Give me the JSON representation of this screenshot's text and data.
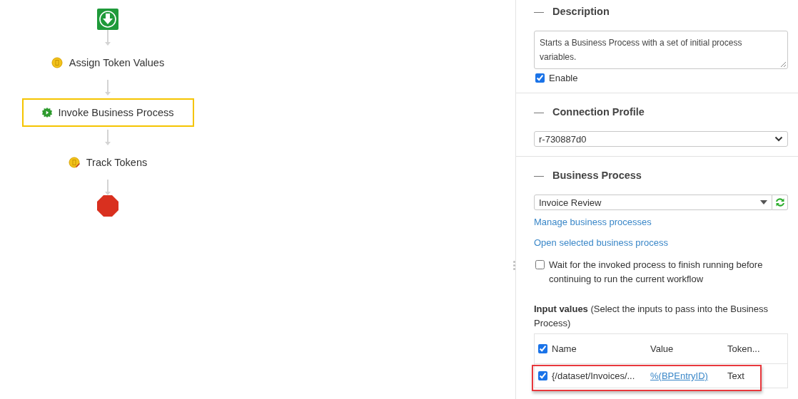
{
  "flow": {
    "nodes": [
      {
        "kind": "start",
        "selected": false
      },
      {
        "kind": "assign",
        "label": "Assign Token Values",
        "selected": false
      },
      {
        "kind": "invoke",
        "label": "Invoke Business Process",
        "selected": true
      },
      {
        "kind": "track",
        "label": "Track Tokens",
        "selected": false
      },
      {
        "kind": "end",
        "selected": false
      }
    ]
  },
  "panel": {
    "description": {
      "title": "Description",
      "collapse": "—",
      "text": "Starts a Business Process with a set of initial process variables.",
      "enable": {
        "label": "Enable",
        "checked": true
      }
    },
    "connection_profile": {
      "title": "Connection Profile",
      "collapse": "—",
      "value": "r-730887d0"
    },
    "business_process": {
      "title": "Business Process",
      "collapse": "—",
      "value": "Invoice Review",
      "links": [
        "Manage business processes",
        "Open selected business process"
      ],
      "wait": {
        "label": "Wait for the invoked process to finish running before continuing to run the current workflow",
        "checked": false
      },
      "input_values": {
        "caption": "**Input values** (Select the inputs to pass into the Business Process)",
        "columns": [
          "Name",
          "Value",
          "Token..."
        ],
        "all_checked": true,
        "rows": [
          {
            "checked": true,
            "name": "{/dataset/Invoices/...",
            "value": "%(BPEntryID)",
            "type": "Text",
            "highlighted": true
          }
        ]
      }
    }
  }
}
